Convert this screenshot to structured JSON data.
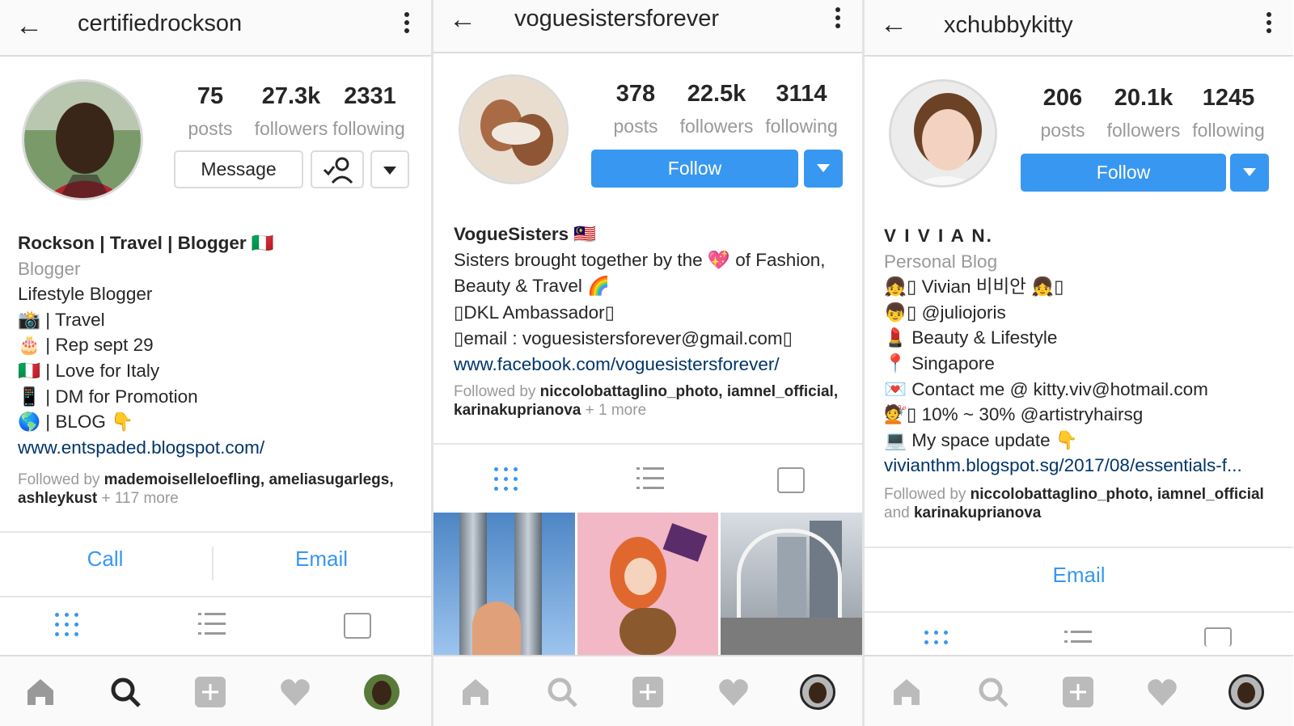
{
  "screens": [
    {
      "username": "certifiedrockson",
      "stats": {
        "posts": "75",
        "posts_label": "posts",
        "followers": "27.3k",
        "followers_label": "followers",
        "following": "2331",
        "following_label": "following"
      },
      "buttons": {
        "message": "Message"
      },
      "bio": {
        "name": "Rockson | Travel | Blogger 🇮🇹",
        "category": "Blogger",
        "lines": [
          "Lifestyle Blogger",
          "📸 | Travel",
          "🎂 | Rep sept 29",
          "🇮🇹 | Love for Italy",
          "📱 | DM for Promotion",
          "🌎 | BLOG 👇"
        ],
        "link": "www.entspaded.blogspot.com/"
      },
      "followed_by": {
        "prefix": "Followed by",
        "names": "mademoiselleloefling, ameliasugarlegs, ashleykust",
        "suffix": "+ 117 more"
      },
      "actions": {
        "call": "Call",
        "email": "Email"
      }
    },
    {
      "username": "voguesistersforever",
      "stats": {
        "posts": "378",
        "posts_label": "posts",
        "followers": "22.5k",
        "followers_label": "followers",
        "following": "3114",
        "following_label": "following"
      },
      "buttons": {
        "follow": "Follow"
      },
      "bio": {
        "name": "VogueSisters 🇲🇾",
        "lines": [
          "Sisters brought together by the 💖 of Fashion,",
          "Beauty & Travel 🌈",
          "▯DKL Ambassador▯",
          "▯email : voguesistersforever@gmail.com▯"
        ],
        "link": "www.facebook.com/voguesistersforever/"
      },
      "followed_by": {
        "prefix": "Followed by",
        "names": "niccolobattaglino_photo, iamnel_official, karinakuprianova",
        "suffix": "+ 1 more"
      }
    },
    {
      "username": "xchubbykitty",
      "stats": {
        "posts": "206",
        "posts_label": "posts",
        "followers": "20.1k",
        "followers_label": "followers",
        "following": "1245",
        "following_label": "following"
      },
      "buttons": {
        "follow": "Follow"
      },
      "bio": {
        "name": "V I V I A N.",
        "category": "Personal Blog",
        "lines": [
          "👧▯ Vivian 비비안 👧▯",
          "👦▯ @juliojoris",
          "💄 Beauty & Lifestyle",
          "📍 Singapore",
          "💌 Contact me @ kitty.viv@hotmail.com",
          "💇▯ 10% ~ 30% @artistryhairsg",
          "💻 My space update 👇"
        ],
        "link": "vivianthm.blogspot.sg/2017/08/essentials-f..."
      },
      "followed_by": {
        "prefix": "Followed by",
        "names": "niccolobattaglino_photo, iamnel_official",
        "and": "and",
        "names2": "karinakuprianova"
      },
      "actions": {
        "email": "Email"
      }
    }
  ],
  "colors": {
    "accent": "#3897f0",
    "link": "#003569",
    "muted": "#999999"
  },
  "icons": [
    "back-arrow-icon",
    "more-vertical-icon",
    "add-person-icon",
    "chevron-down-icon",
    "grid-icon",
    "list-icon",
    "tagged-icon",
    "home-icon",
    "search-icon",
    "add-icon",
    "heart-icon",
    "profile-icon"
  ]
}
